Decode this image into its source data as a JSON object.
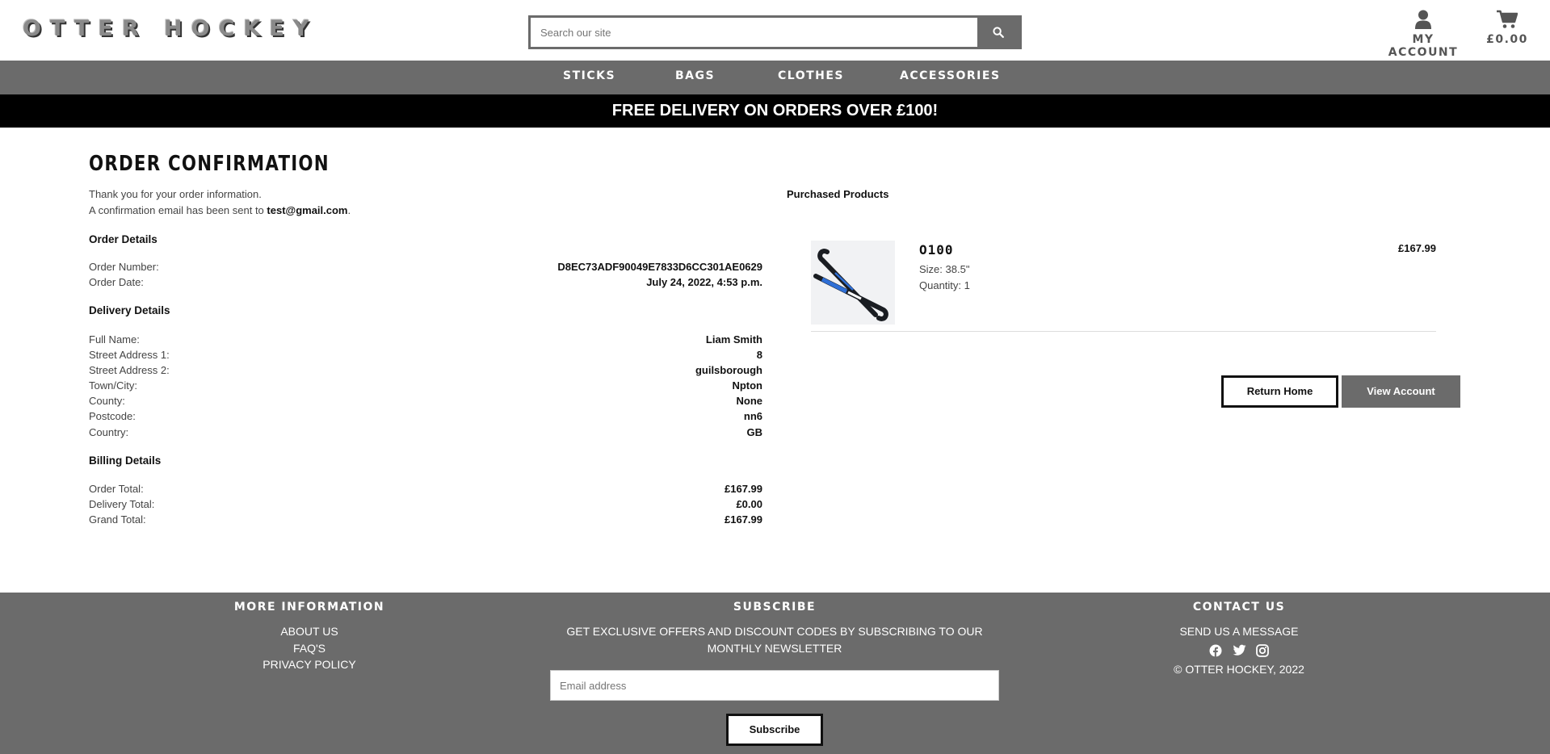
{
  "header": {
    "logo": "OTTER HOCKEY",
    "search_placeholder": "Search our site",
    "account_label": "MY ACCOUNT",
    "bag_total": "£0.00"
  },
  "nav": {
    "items": [
      "STICKS",
      "BAGS",
      "CLOTHES",
      "ACCESSORIES"
    ]
  },
  "banner": "FREE DELIVERY ON ORDERS OVER £100!",
  "page": {
    "title": "ORDER CONFIRMATION",
    "thanks": "Thank you for your order information.",
    "email_prefix": "A confirmation email has been sent to ",
    "email": "test@gmail.com",
    "email_suffix": "."
  },
  "order_details": {
    "heading": "Order Details",
    "rows": [
      {
        "label": "Order Number:",
        "value": "D8EC73ADF90049E7833D6CC301AE0629"
      },
      {
        "label": "Order Date:",
        "value": "July 24, 2022, 4:53 p.m."
      }
    ]
  },
  "delivery_details": {
    "heading": "Delivery Details",
    "rows": [
      {
        "label": "Full Name:",
        "value": "Liam Smith"
      },
      {
        "label": "Street Address 1:",
        "value": "8"
      },
      {
        "label": "Street Address 2:",
        "value": "guilsborough"
      },
      {
        "label": "Town/City:",
        "value": "Npton"
      },
      {
        "label": "County:",
        "value": "None"
      },
      {
        "label": "Postcode:",
        "value": "nn6"
      },
      {
        "label": "Country:",
        "value": "GB"
      }
    ]
  },
  "billing_details": {
    "heading": "Billing Details",
    "rows": [
      {
        "label": "Order Total:",
        "value": "£167.99"
      },
      {
        "label": "Delivery Total:",
        "value": "£0.00"
      },
      {
        "label": "Grand Total:",
        "value": "£167.99"
      }
    ]
  },
  "purchased": {
    "heading": "Purchased Products",
    "product": {
      "name": "O100",
      "size": "Size: 38.5\"",
      "quantity": "Quantity: 1",
      "price": "£167.99"
    }
  },
  "buttons": {
    "return_home": "Return Home",
    "view_account": "View Account"
  },
  "footer": {
    "more_info": {
      "heading": "MORE INFORMATION",
      "links": [
        "ABOUT US",
        "FAQ'S",
        "PRIVACY POLICY"
      ]
    },
    "subscribe": {
      "heading": "SUBSCRIBE",
      "text_line1": "GET EXCLUSIVE OFFERS AND DISCOUNT CODES BY SUBSCRIBING TO OUR",
      "text_line2": "MONTHLY NEWSLETTER",
      "email_placeholder": "Email address",
      "button": "Subscribe"
    },
    "contact": {
      "heading": "CONTACT US",
      "message_link": "SEND US A MESSAGE",
      "copyright": "© OTTER HOCKEY, 2022"
    }
  },
  "colors": {
    "nav_grey": "#6b6b6b",
    "banner_black": "#000000"
  }
}
